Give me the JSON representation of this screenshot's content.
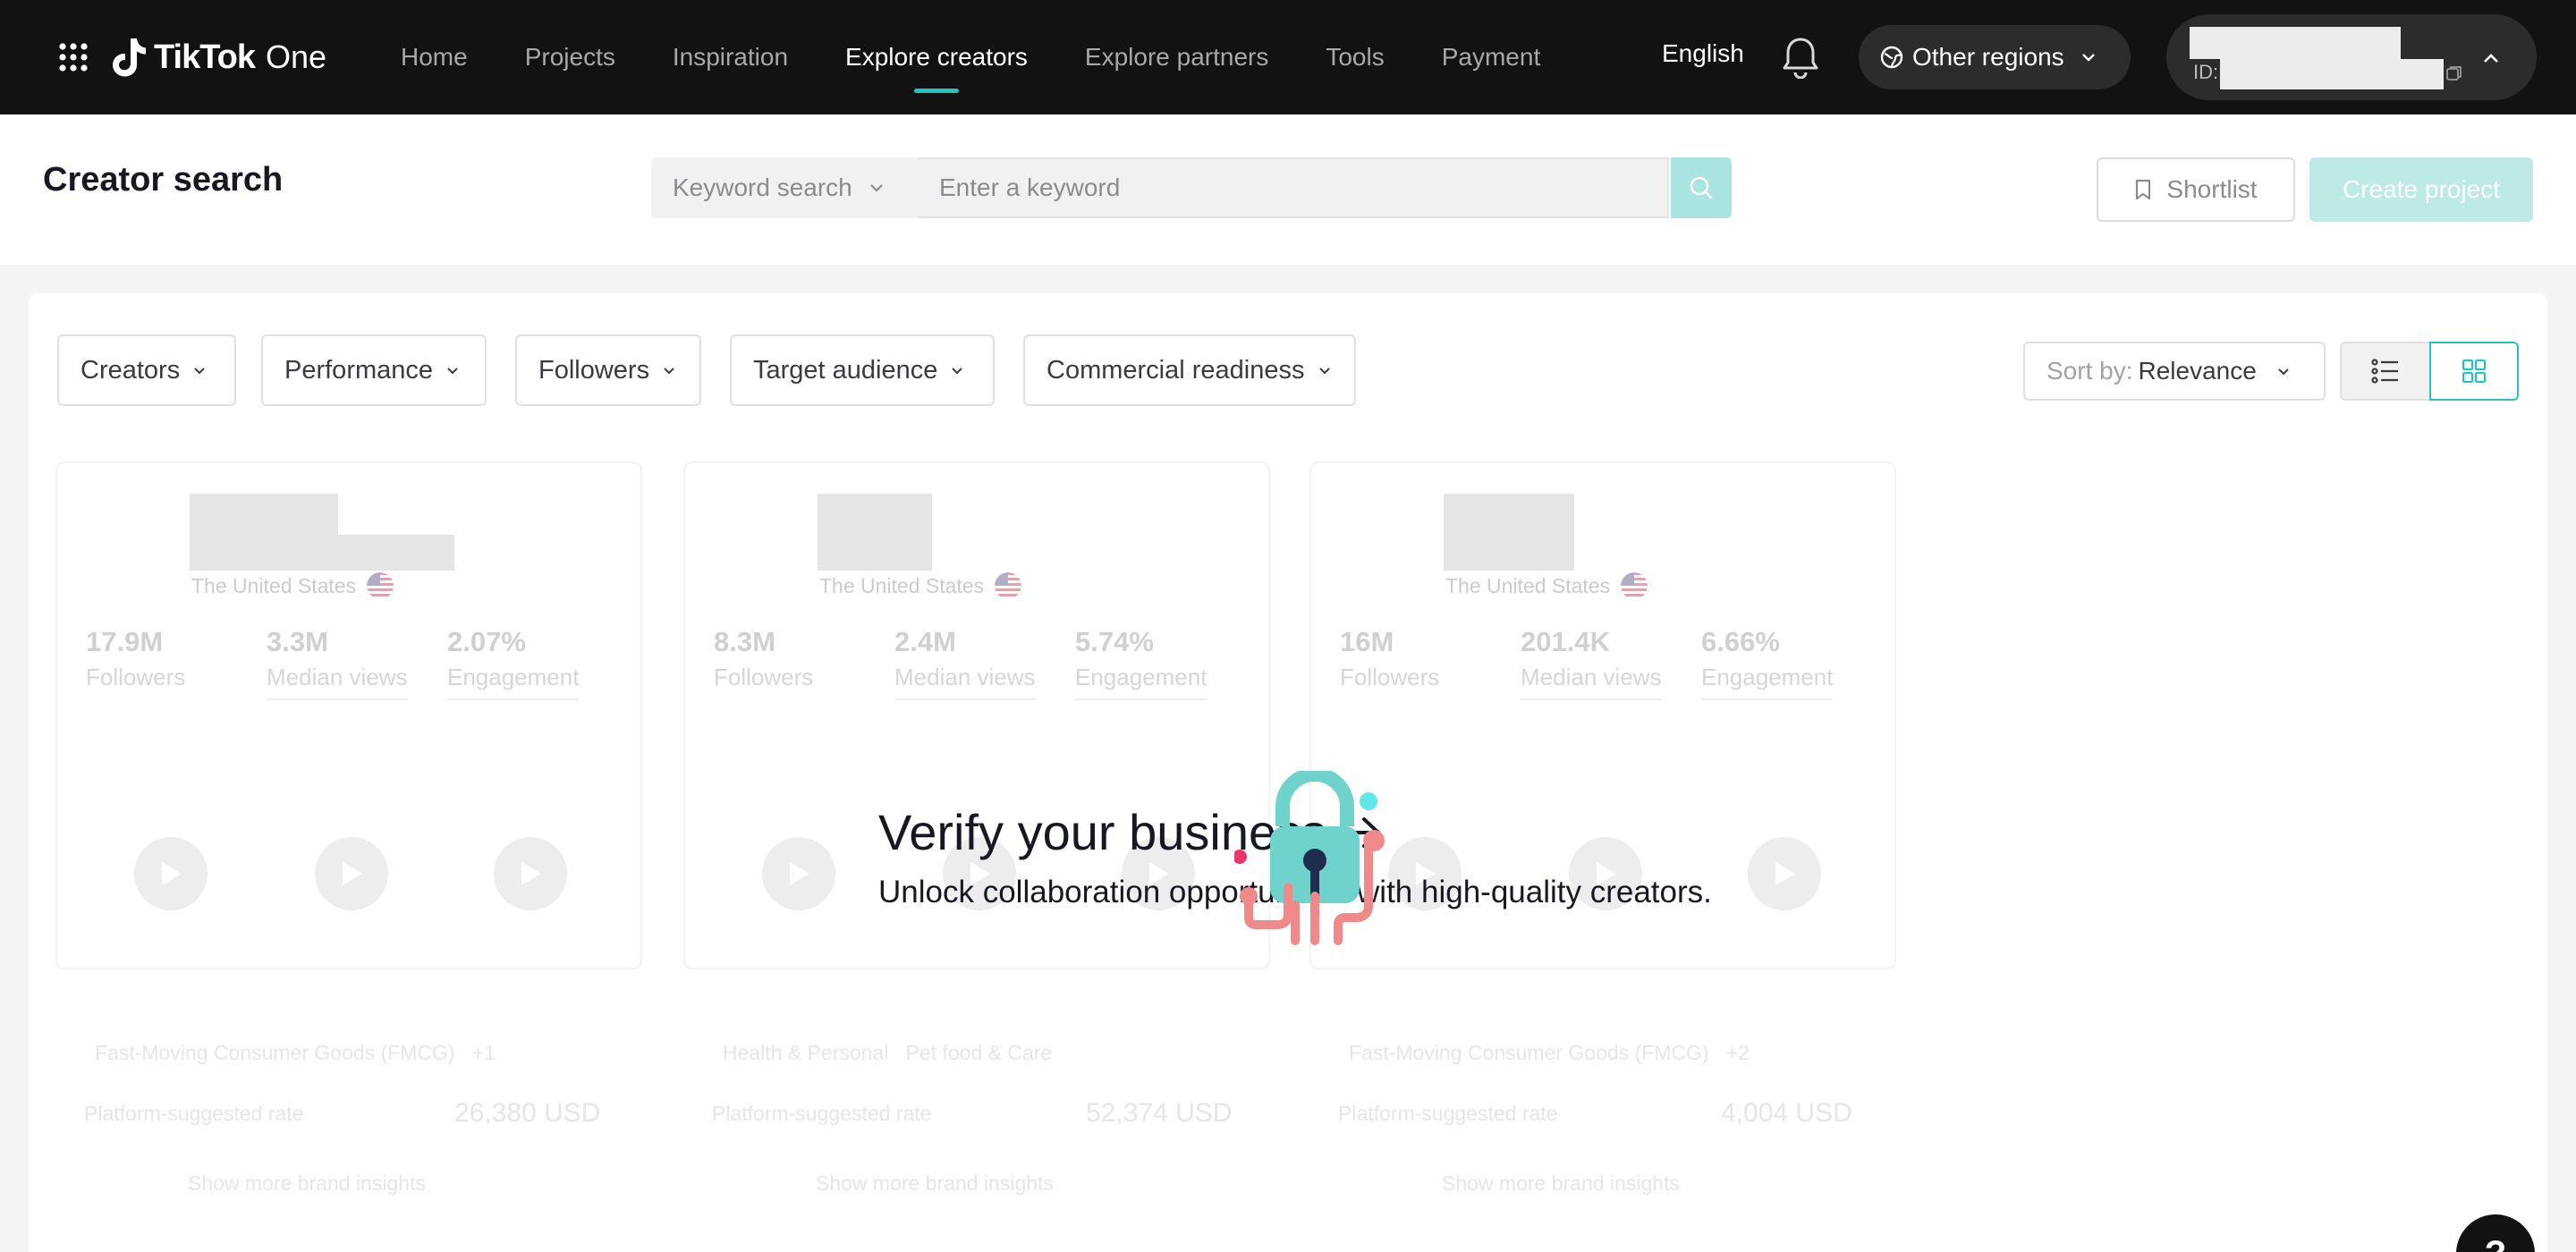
{
  "nav": {
    "brand": "TikTok",
    "brand_suffix": "One",
    "links": [
      "Home",
      "Projects",
      "Inspiration",
      "Explore creators",
      "Explore partners",
      "Tools",
      "Payment"
    ],
    "active_link": "Explore creators",
    "language": "English",
    "region": "Other regions",
    "account_id_label": "ID:",
    "accent_color": "#25c3bd"
  },
  "header": {
    "title": "Creator search",
    "search_type": "Keyword search",
    "search_placeholder": "Enter a keyword",
    "shortlist": "Shortlist",
    "create_project": "Create project"
  },
  "filters": [
    "Creators",
    "Performance",
    "Followers",
    "Target audience",
    "Commercial readiness"
  ],
  "sort": {
    "label": "Sort by:",
    "value": "Relevance"
  },
  "view_mode": "grid",
  "cards": [
    {
      "country": "The United States",
      "followers": "17.9M",
      "followers_label": "Followers",
      "median_views": "3.3M",
      "median_views_label": "Median views",
      "engagement": "2.07%",
      "engagement_label": "Engagement",
      "category": "Fast-Moving Consumer Goods (FMCG)",
      "category_extra": "+1",
      "rate_label": "Platform-suggested rate",
      "rate": "26,380 USD",
      "footer_link": "Show more brand insights"
    },
    {
      "country": "The United States",
      "followers": "8.3M",
      "followers_label": "Followers",
      "median_views": "2.4M",
      "median_views_label": "Median views",
      "engagement": "5.74%",
      "engagement_label": "Engagement",
      "category": "Health & Personal",
      "category_extra": "Pet food & Care",
      "rate_label": "Platform-suggested rate",
      "rate": "52,374 USD",
      "footer_link": "Show more brand insights"
    },
    {
      "country": "The United States",
      "followers": "16M",
      "followers_label": "Followers",
      "median_views": "201.4K",
      "median_views_label": "Median views",
      "engagement": "6.66%",
      "engagement_label": "Engagement",
      "category": "Fast-Moving Consumer Goods (FMCG)",
      "category_extra": "+2",
      "rate_label": "Platform-suggested rate",
      "rate": "4,004 USD",
      "footer_link": "Show more brand insights"
    }
  ],
  "overlay": {
    "title": "Verify your business",
    "subtitle": "Unlock collaboration opportunities with high-quality creators."
  },
  "help_label": "?"
}
